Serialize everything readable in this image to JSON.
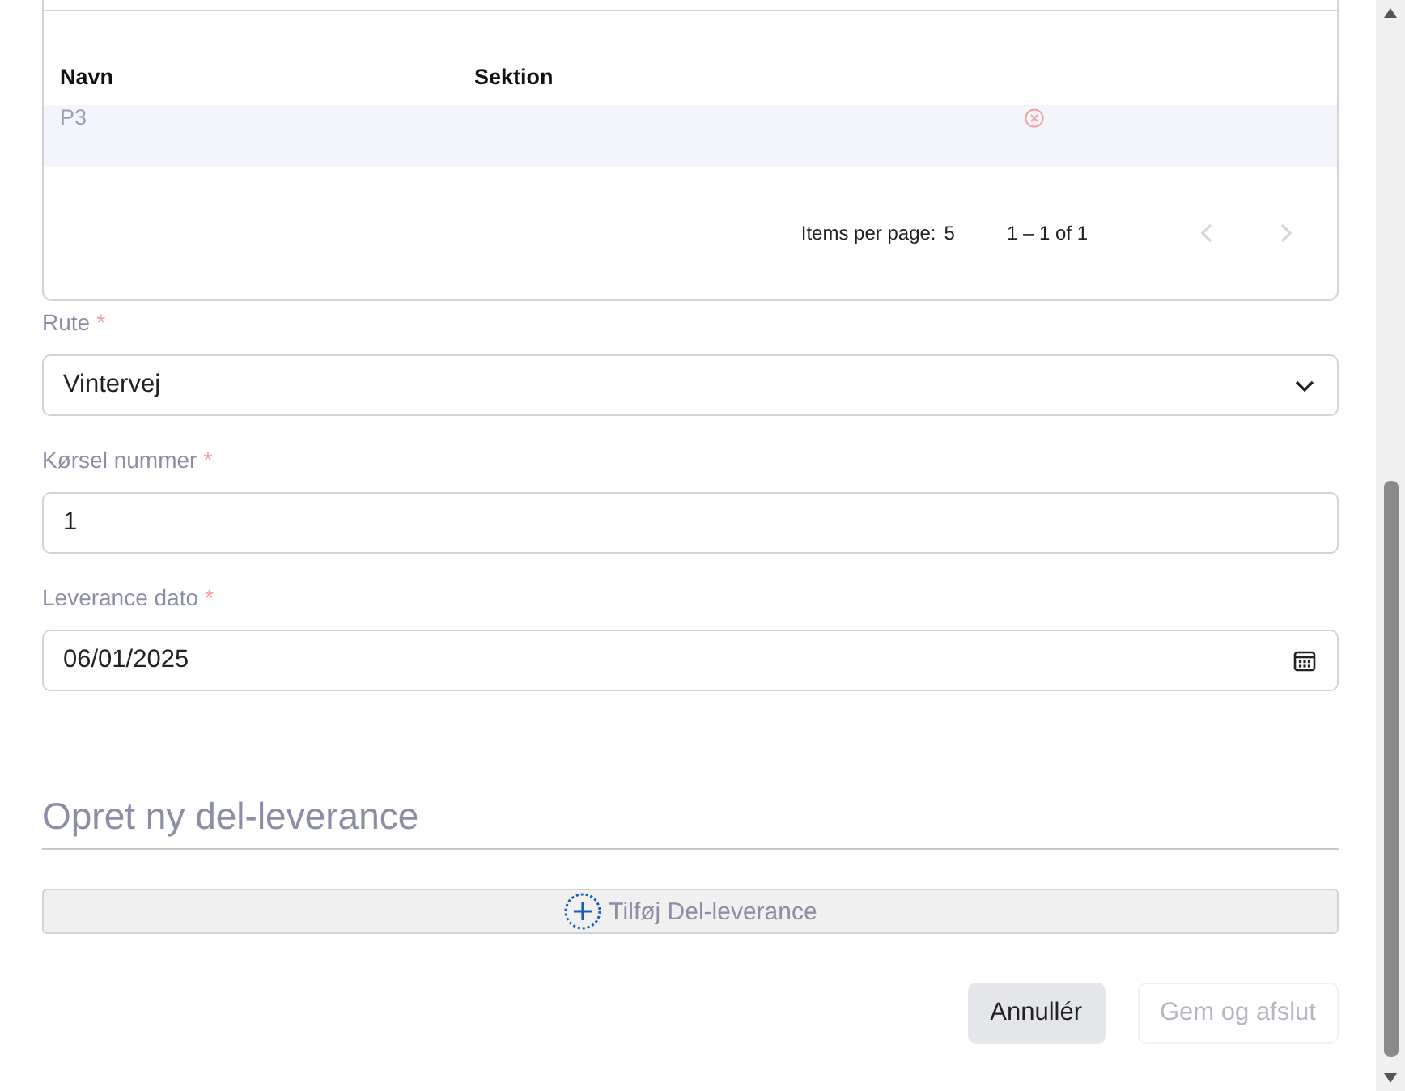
{
  "table": {
    "columns": [
      "Navn",
      "Sektion"
    ],
    "rows": [
      {
        "name": "P3",
        "section": ""
      }
    ],
    "paginator": {
      "items_per_page_label": "Items per page:",
      "items_per_page": "5",
      "range": "1 – 1 of 1",
      "prev_disabled": true,
      "next_disabled": true
    }
  },
  "fields": [
    {
      "kind": "select",
      "label": "Rute",
      "required_mark": "*",
      "value": "Vintervej"
    },
    {
      "kind": "text",
      "label": "Kørsel nummer",
      "required_mark": "*",
      "value": "1"
    },
    {
      "kind": "date",
      "label": "Leverance dato",
      "required_mark": "*",
      "value": "06/01/2025"
    }
  ],
  "section_title": "Opret ny del-leverance",
  "add_button": "Tilføj Del-leverance",
  "buttons": [
    {
      "label": "Annullér",
      "disabled": false
    },
    {
      "label": "Gem og afslut",
      "disabled": true
    }
  ]
}
